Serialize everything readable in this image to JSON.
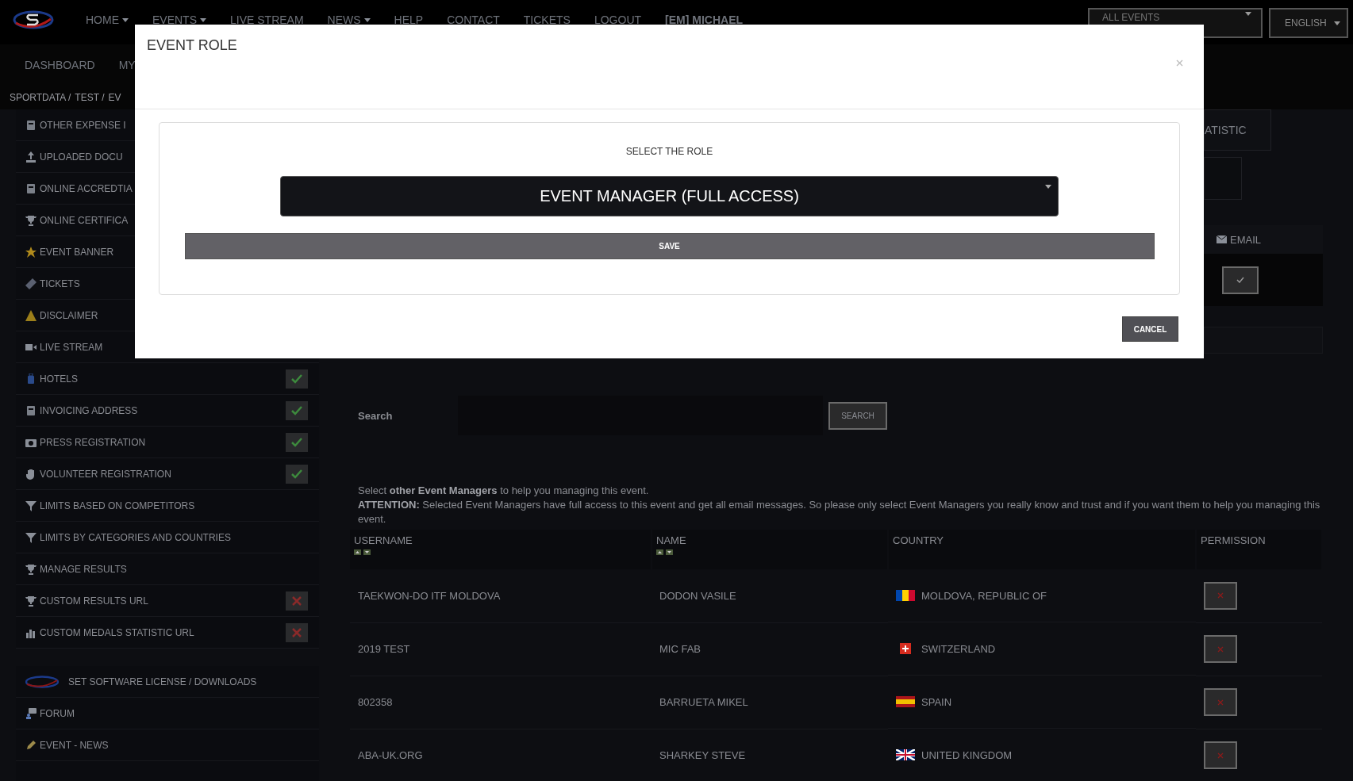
{
  "nav": {
    "items": [
      {
        "label": "HOME",
        "dropdown": true
      },
      {
        "label": "EVENTS",
        "dropdown": true
      },
      {
        "label": "LIVE STREAM",
        "dropdown": false
      },
      {
        "label": "NEWS",
        "dropdown": true
      },
      {
        "label": "HELP",
        "dropdown": false
      },
      {
        "label": "CONTACT",
        "dropdown": false
      },
      {
        "label": "TICKETS",
        "dropdown": false
      },
      {
        "label": "LOGOUT",
        "dropdown": false
      }
    ],
    "user": "[EM] MICHAEL",
    "events_select": "ALL EVENTS",
    "language_select": "ENGLISH"
  },
  "subnav": [
    "DASHBOARD",
    "MY"
  ],
  "breadcrumb": [
    "SPORTDATA /",
    "TEST /",
    "EV"
  ],
  "sidebar": {
    "items": [
      {
        "label": "OTHER EXPENSE I"
      },
      {
        "label": "UPLOADED DOCU"
      },
      {
        "label": "ONLINE ACCREDTIA"
      },
      {
        "label": "ONLINE CERTIFICA"
      },
      {
        "label": "EVENT BANNER"
      },
      {
        "label": "TICKETS"
      },
      {
        "label": "DISCLAIMER"
      },
      {
        "label": "LIVE STREAM"
      },
      {
        "label": "HOTELS",
        "on": true
      },
      {
        "label": "INVOICING ADDRESS",
        "on": true
      },
      {
        "label": "PRESS REGISTRATION",
        "on": true
      },
      {
        "label": "VOLUNTEER REGISTRATION",
        "on": true
      },
      {
        "label": "LIMITS BASED ON COMPETITORS"
      },
      {
        "label": "LIMITS BY CATEGORIES AND COUNTRIES"
      },
      {
        "label": "MANAGE RESULTS"
      },
      {
        "label": "CUSTOM RESULTS URL",
        "on": false
      },
      {
        "label": "CUSTOM MEDALS STATISTIC URL",
        "on": false
      }
    ],
    "links": [
      "SET SOFTWARE LICENSE / DOWNLOADS",
      "FORUM",
      "EVENT - NEWS"
    ]
  },
  "side_panel": {
    "tab": "ATISTIC",
    "email_header": "EMAIL",
    "email_checked": true
  },
  "search": {
    "label": "Search",
    "button": "SEARCH"
  },
  "notice": {
    "line": "Select **other Event Managers** to help you managing this event.",
    "attention": "**ATTENTION:** Selected Event Managers have full access to this event and get all email messages. So please only select Event Managers you really know and trust and if you want them to help you managing this event."
  },
  "table": {
    "columns": [
      "USERNAME",
      "NAME",
      "COUNTRY",
      "PERMISSION"
    ],
    "rows": [
      {
        "username": "TAEKWON-DO ITF MOLDOVA",
        "name": "DODON VASILE",
        "country": "MOLDOVA, REPUBLIC OF"
      },
      {
        "username": "2019 TEST",
        "name": "MIC FAB",
        "country": "SWITZERLAND"
      },
      {
        "username": "802358",
        "name": "BARRUETA MIKEL",
        "country": "SPAIN"
      },
      {
        "username": "ABA-UK.ORG",
        "name": "SHARKEY STEVE",
        "country": "UNITED KINGDOM"
      }
    ]
  },
  "modal": {
    "title": "EVENT ROLE",
    "prompt": "SELECT THE ROLE",
    "role": "EVENT MANAGER (FULL ACCESS)",
    "save": "SAVE",
    "cancel": "CANCEL"
  }
}
